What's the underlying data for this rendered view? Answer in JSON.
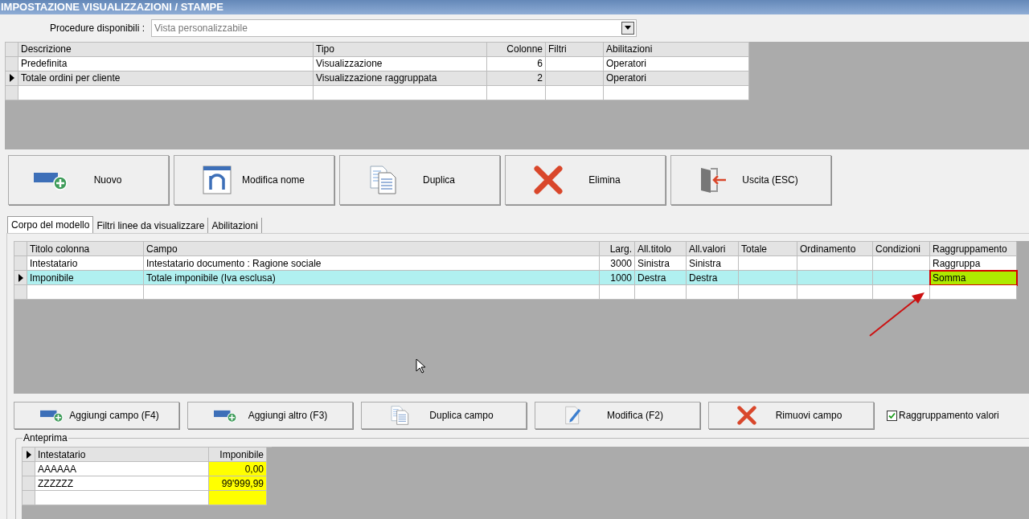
{
  "window": {
    "title": "IMPOSTAZIONE VISUALIZZAZIONI / STAMPE"
  },
  "procedure": {
    "label": "Procedure disponibili :",
    "value": "Vista personalizzabile"
  },
  "views_table": {
    "columns": [
      "Descrizione",
      "Tipo",
      "Colonne",
      "Filtri",
      "Abilitazioni"
    ],
    "rows": [
      {
        "cells": [
          "Predefinita",
          "Visualizzazione",
          "6",
          "",
          "Operatori"
        ],
        "selected": false
      },
      {
        "cells": [
          "Totale ordini per cliente",
          "Visualizzazione raggruppata",
          "2",
          "",
          "Operatori"
        ],
        "selected": true
      }
    ]
  },
  "actions": [
    {
      "label": "Nuovo",
      "kind": "add"
    },
    {
      "label": "Modifica nome",
      "kind": "rename"
    },
    {
      "label": "Duplica",
      "kind": "copy"
    },
    {
      "label": "Elimina",
      "kind": "delete"
    },
    {
      "label": "Uscita (ESC)",
      "kind": "exit"
    }
  ],
  "tabs": [
    {
      "label": "Corpo del modello",
      "selected": true
    },
    {
      "label": "Filtri linee da visualizzare",
      "selected": false
    },
    {
      "label": "Abilitazioni",
      "selected": false
    }
  ],
  "fields_table": {
    "columns": [
      "Titolo colonna",
      "Campo",
      "Larg.",
      "All.titolo",
      "All.valori",
      "Totale",
      "Ordinamento",
      "Condizioni",
      "Raggruppamento"
    ],
    "rows": [
      {
        "cells": [
          "Intestatario",
          "Intestatario documento : Ragione sociale",
          "3000",
          "Sinistra",
          "Sinistra",
          "",
          "",
          "",
          "Raggruppa"
        ],
        "selected": false,
        "focused_cell": false
      },
      {
        "cells": [
          "Imponibile",
          "Totale imponibile (Iva esclusa)",
          "1000",
          "Destra",
          "Destra",
          "",
          "",
          "",
          "Somma"
        ],
        "selected": true,
        "focused_cell": true
      }
    ]
  },
  "field_actions": [
    {
      "label": "Aggiungi campo (F4)",
      "kind": "add"
    },
    {
      "label": "Aggiungi altro (F3)",
      "kind": "add"
    },
    {
      "label": "Duplica campo",
      "kind": "copy"
    },
    {
      "label": "Modifica (F2)",
      "kind": "edit"
    },
    {
      "label": "Rimuovi campo",
      "kind": "delete"
    }
  ],
  "grouping_checkbox": {
    "label": "Raggruppamento valori",
    "checked": true
  },
  "preview": {
    "title": "Anteprima",
    "columns": [
      "Intestatario",
      "Imponibile"
    ],
    "rows": [
      [
        "AAAAAA",
        "0,00"
      ],
      [
        "ZZZZZZ",
        "99'999,99"
      ]
    ]
  }
}
